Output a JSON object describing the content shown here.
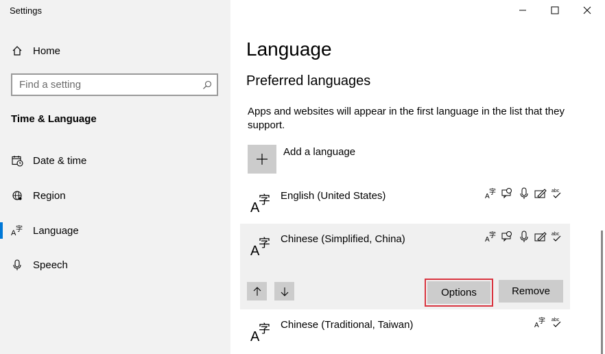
{
  "window": {
    "title": "Settings"
  },
  "sidebar": {
    "home_label": "Home",
    "search_placeholder": "Find a setting",
    "section_title": "Time & Language",
    "items": [
      {
        "label": "Date & time",
        "icon": "calendar-clock-icon"
      },
      {
        "label": "Region",
        "icon": "globe-icon"
      },
      {
        "label": "Language",
        "icon": "language-icon",
        "active": true
      },
      {
        "label": "Speech",
        "icon": "microphone-icon"
      }
    ]
  },
  "main": {
    "title": "Language",
    "section_title": "Preferred languages",
    "description": "Apps and websites will appear in the first language in the list that they support.",
    "add_label": "Add a language",
    "languages": [
      {
        "name": "English (United States)"
      },
      {
        "name": "Chinese (Simplified, China)",
        "selected": true
      },
      {
        "name": "Chinese (Traditional, Taiwan)"
      }
    ],
    "feature_icon_text": "abc",
    "options_label": "Options",
    "remove_label": "Remove"
  },
  "colors": {
    "accent": "#0078d7",
    "highlight": "#d9343f",
    "button": "#cccccc",
    "sidebar": "#f2f2f2"
  }
}
